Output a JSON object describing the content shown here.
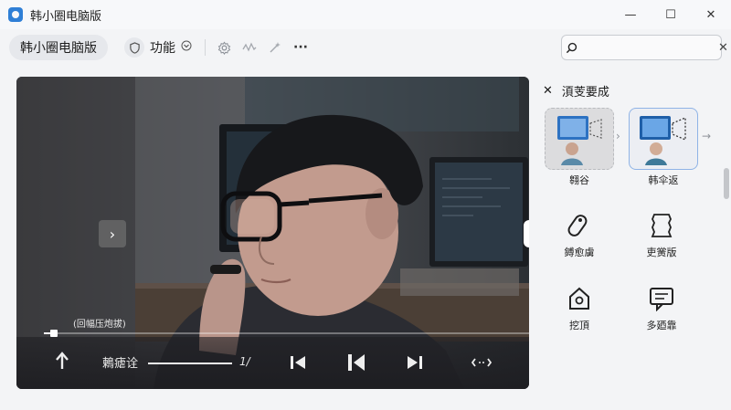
{
  "window": {
    "title": "韩小圈电脑版",
    "minimize_glyph": "—",
    "maximize_glyph": "☐",
    "close_glyph": "✕"
  },
  "toolbar": {
    "brand_label": "韩小圈电脑版",
    "feature_label": "功能",
    "more_glyph": "···",
    "search": {
      "value": "",
      "placeholder": ""
    }
  },
  "player": {
    "next_glyph": "›",
    "subtitle": "(回幅压炮拔)",
    "progress": 0.02,
    "speed_label": "鶫瘧诠",
    "volume": 1.0,
    "rate_value": "1/"
  },
  "panel": {
    "title": "湏芰要成",
    "cards": [
      {
        "label": "翱谷"
      },
      {
        "label": "韩伞返"
      }
    ],
    "tools": [
      {
        "label": "鎛愈虜",
        "icon": "tag-icon"
      },
      {
        "label": "吏黉版",
        "icon": "badge-icon"
      },
      {
        "label": "挖頂",
        "icon": "house-icon"
      },
      {
        "label": "多廼靠",
        "icon": "chat-icon"
      }
    ]
  },
  "colors": {
    "accent": "#2f7fd6",
    "card_border": "#8fb3e6"
  }
}
